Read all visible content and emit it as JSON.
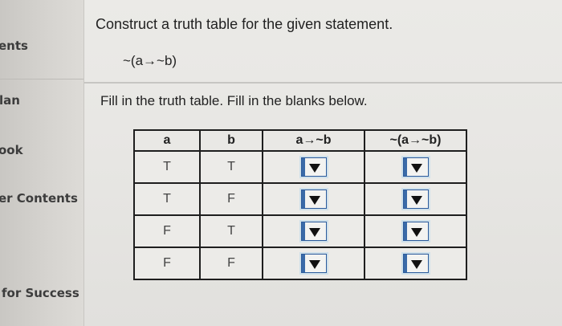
{
  "sidebar": {
    "items": [
      "ents",
      "lan",
      "ook",
      "er Contents",
      "for Success"
    ]
  },
  "question": {
    "prompt": "Construct a truth table for the given statement.",
    "statement": "~(a→~b)",
    "instruction": "Fill in the truth table. Fill in the blanks below."
  },
  "table": {
    "headers": [
      "a",
      "b",
      "a→~b",
      "~(a→~b)"
    ],
    "rows": [
      {
        "a": "T",
        "b": "T"
      },
      {
        "a": "T",
        "b": "F"
      },
      {
        "a": "F",
        "b": "T"
      },
      {
        "a": "F",
        "b": "F"
      }
    ]
  }
}
